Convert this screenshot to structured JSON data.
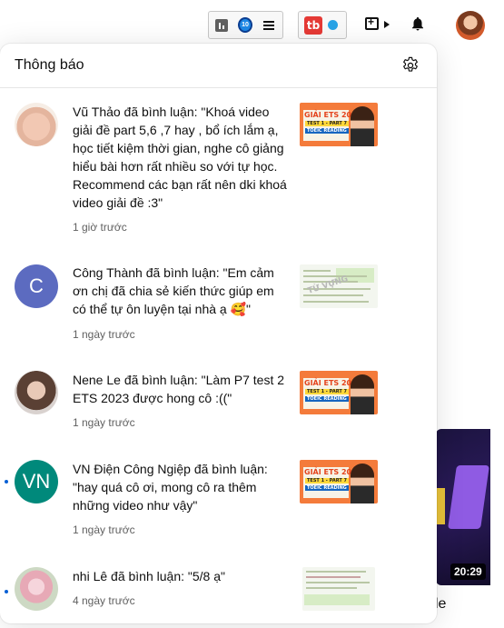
{
  "topbar": {
    "ext1_logo_text": "tb",
    "ext2_logo_text": "tb",
    "icons": [
      "stats-icon",
      "extension-logo-icon",
      "menu-icon",
      "tubebuddy-icon",
      "status-dot-icon",
      "create-video-icon",
      "bell-icon",
      "account-avatar"
    ]
  },
  "panel": {
    "title": "Thông báo",
    "settings_icon": "gear-icon",
    "notifications": [
      {
        "avatar_letter": "",
        "text": "Vũ Thảo đã bình luận: \"Khoá video giải đề part 5,6 ,7 hay , bổ ích lắm ạ, học tiết kiệm thời gian, nghe cô giảng hiểu bài hơn rất nhiều so với tự học. Recommend các bạn rất nên dki khoá video giải đề :3\"",
        "time": "1 giờ trước",
        "unread": false
      },
      {
        "avatar_letter": "C",
        "text": "Công Thành đã bình luận: \"Em cảm ơn chị đã chia sẻ kiến thức giúp em có thể tự ôn luyện tại nhà ạ 🥰\"",
        "time": "1 ngày trước",
        "unread": false
      },
      {
        "avatar_letter": "",
        "text": "Nene Le đã bình luận: \"Làm P7 test 2 ETS 2023 được hong cô :((\"",
        "time": "1 ngày trước",
        "unread": false
      },
      {
        "avatar_letter": "VN",
        "text": "VN Điện Công Ngiệp đã bình luận: \"hay quá cô ơi, mong cô ra thêm những video như vậy\"",
        "time": "1 ngày trước",
        "unread": true
      },
      {
        "avatar_letter": "",
        "text": "nhi Lê đã bình luận: \"5/8 ạ\"",
        "time": "4 ngày trước",
        "unread": true
      }
    ],
    "thumb_ets": {
      "title": "GIẢI ETS 2023",
      "sub1": "TEST 1 - PART 7",
      "sub2": "TOEIC READING"
    },
    "thumb_doc_watermark": "TỪ VỰNG"
  },
  "background": {
    "duration": "20:29",
    "side_text": "le"
  },
  "colors": {
    "accent_blue": "#065fd4",
    "avatar_c": "#5c6bc0",
    "avatar_vn": "#00897b",
    "thumb_orange": "#f47b3b"
  }
}
